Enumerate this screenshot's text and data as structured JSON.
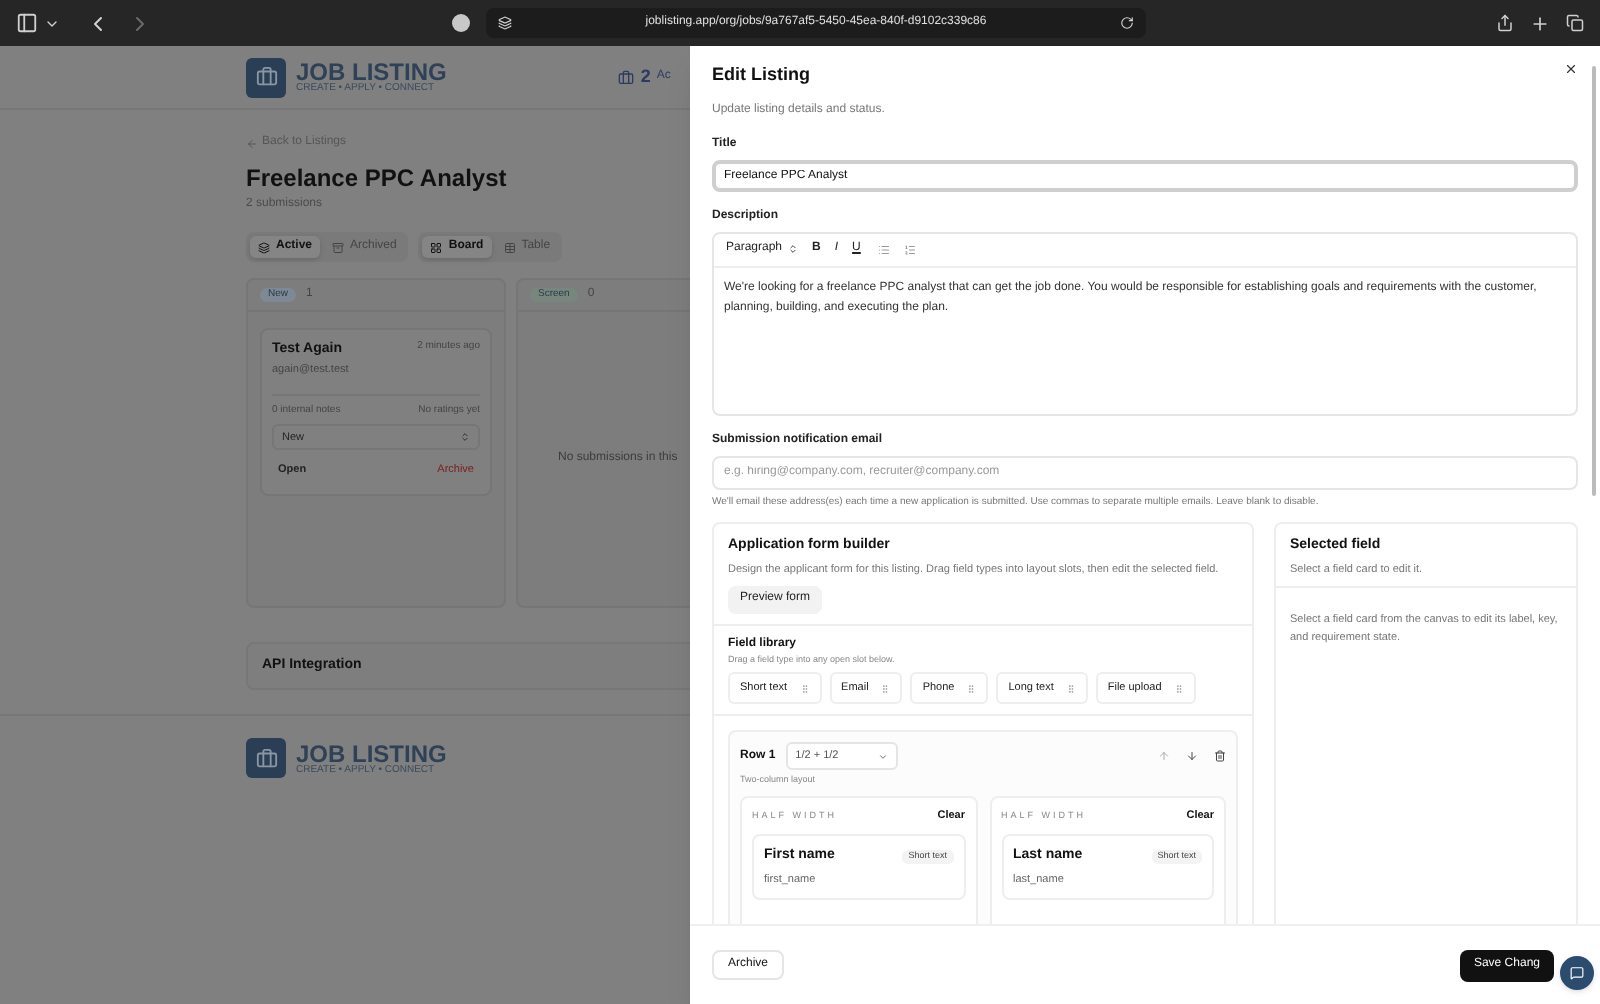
{
  "browser": {
    "url": "joblisting.app/org/jobs/9a767af5-5450-45ea-840f-d9102c339c86"
  },
  "header": {
    "logo": {
      "name": "JOB LISTING",
      "tagline": "CREATE • APPLY • CONNECT"
    },
    "count": "2",
    "count_label": "Ac"
  },
  "page": {
    "back_link": "Back to Listings",
    "title": "Freelance PPC Analyst",
    "subtitle": "2 submissions",
    "filters": [
      {
        "label": "Active",
        "selected": true
      },
      {
        "label": "Archived",
        "selected": false
      }
    ],
    "views": [
      {
        "label": "Board",
        "selected": true
      },
      {
        "label": "Table",
        "selected": false
      }
    ],
    "columns": [
      {
        "stage": "New",
        "count": "1",
        "color": "#7d8995",
        "cards": [
          {
            "name": "Test Again",
            "time": "2 minutes ago",
            "email": "again@test.test",
            "notes": "0 internal notes",
            "rating": "No ratings yet",
            "stage_select": "New",
            "status": "Open",
            "archive": "Archive"
          }
        ]
      },
      {
        "stage": "Screen",
        "count": "0",
        "color": "#77877e",
        "empty_text": "No submissions in this"
      }
    ],
    "api_section": "API Integration"
  },
  "footer": {
    "logo": {
      "name": "JOB LISTING",
      "tagline": "CREATE • APPLY • CONNECT"
    }
  },
  "drawer": {
    "title": "Edit Listing",
    "subtitle": "Update listing details and status.",
    "title_label": "Title",
    "title_value": "Freelance PPC Analyst",
    "description_label": "Description",
    "block_type": "Paragraph",
    "format_buttons": [
      "B",
      "I",
      "U"
    ],
    "description": "We're looking for a freelance PPC analyst that can get the job done. You would be responsible for establishing goals and requirements with the customer, planning, building, and executing the plan.",
    "email_label": "Submission notification email",
    "email_placeholder": "e.g. hiring@company.com, recruiter@company.com",
    "email_help": "We'll email these address(es) each time a new application is submitted. Use commas to separate multiple emails. Leave blank to disable.",
    "builder": {
      "title": "Application form builder",
      "description": "Design the applicant form for this listing. Drag field types into layout slots, then edit the selected field.",
      "preview_button": "Preview form",
      "library_title": "Field library",
      "library_hint": "Drag a field type into any open slot below.",
      "field_types": [
        "Short text",
        "Email",
        "Phone",
        "Long text",
        "File upload"
      ],
      "rows": [
        {
          "label": "Row 1",
          "layout": "1/2 + 1/2",
          "layout_hint": "Two-column layout",
          "slots": [
            {
              "width": "HALF WIDTH",
              "clear": "Clear",
              "field": {
                "label": "First name",
                "type": "Short text",
                "key": "first_name"
              }
            },
            {
              "width": "HALF WIDTH",
              "clear": "Clear",
              "field": {
                "label": "Last name",
                "type": "Short text",
                "key": "last_name"
              }
            }
          ]
        }
      ]
    },
    "selected_field": {
      "title": "Selected field",
      "subtitle": "Select a field card to edit it.",
      "empty_text": "Select a field card from the canvas to edit its label, key, and requirement state."
    },
    "archive_button": "Archive",
    "save_button": "Save Chang"
  }
}
